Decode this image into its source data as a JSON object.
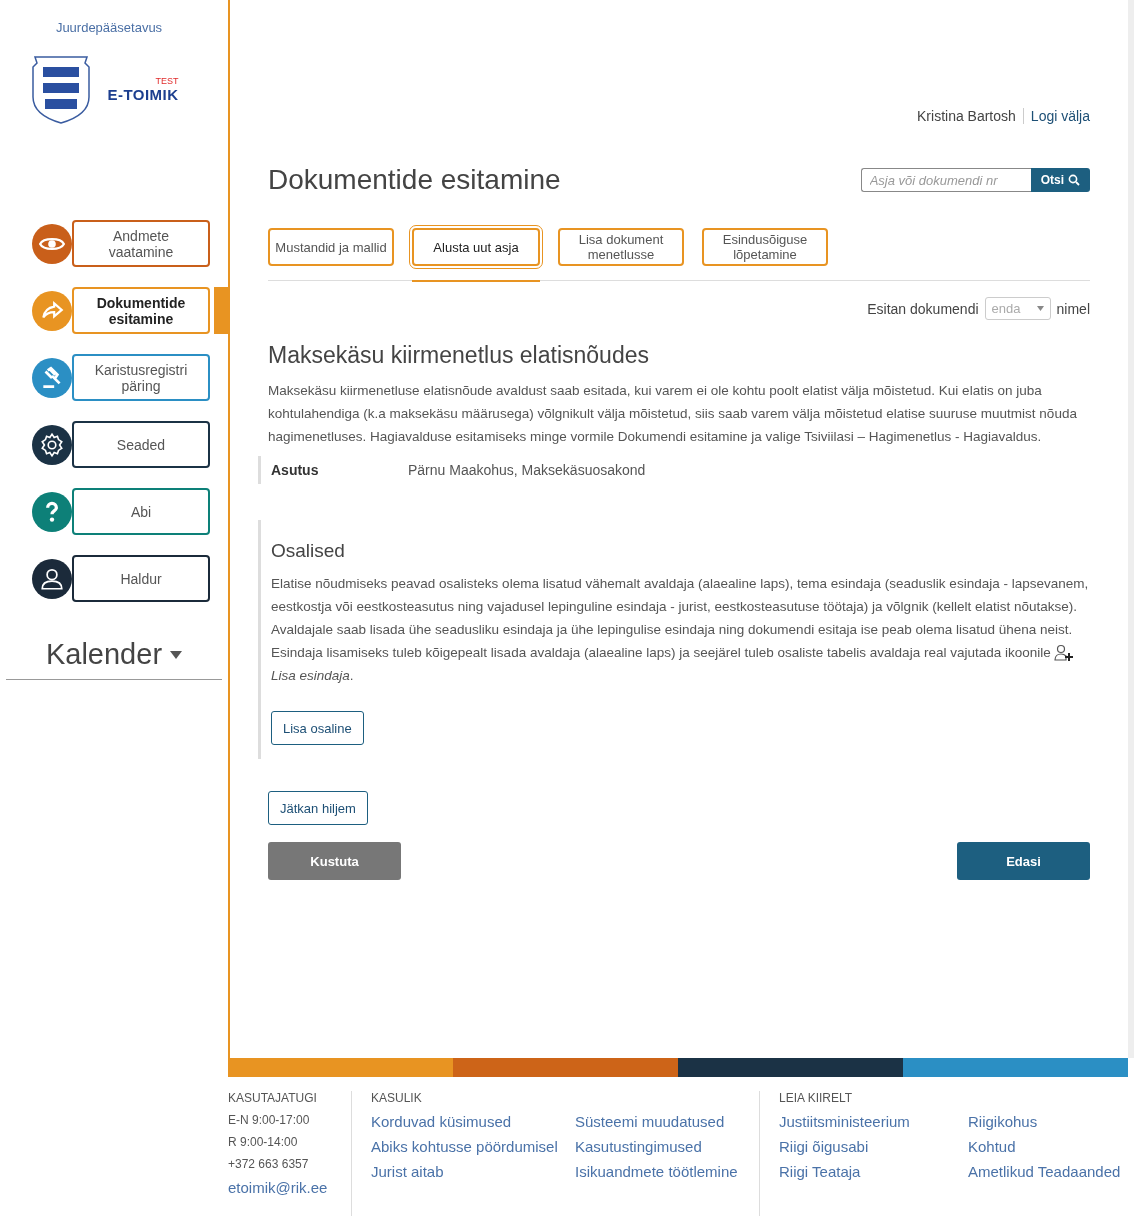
{
  "sidebar": {
    "accessibility_link": "Juurdepääsetavus",
    "logo": {
      "badge": "TEST",
      "name": "E-TOIMIK"
    },
    "nav": [
      {
        "label": "Andmete vaatamine",
        "color": "#c95f1a",
        "selected": false
      },
      {
        "label": "Dokumentide esitamine",
        "color": "#e89422",
        "selected": true
      },
      {
        "label": "Karistusregistri päring",
        "color": "#2b8fc4",
        "selected": false
      },
      {
        "label": "Seaded",
        "color": "#1b3245",
        "selected": false
      },
      {
        "label": "Abi",
        "color": "#0d8078",
        "selected": false
      },
      {
        "label": "Haldur",
        "color": "#1b2a3a",
        "selected": false
      }
    ],
    "calendar": "Kalender"
  },
  "header": {
    "user": "Kristina Bartosh",
    "logout": "Logi välja"
  },
  "page_title": "Dokumentide esitamine",
  "search": {
    "placeholder": "Asja või dokumendi nr",
    "button": "Otsi"
  },
  "tabs": [
    {
      "label": "Mustandid ja mallid",
      "selected": false
    },
    {
      "label": "Alusta uut asja",
      "selected": true
    },
    {
      "label": "Lisa dokument menetlusse",
      "selected": false
    },
    {
      "label": "Esindusõiguse lõpetamine",
      "selected": false
    }
  ],
  "submit_as": {
    "prefix": "Esitan dokumendi",
    "value": "enda",
    "suffix": "nimel"
  },
  "section": {
    "title": "Maksekäsu kiirmenetlus elatisnõudes",
    "description": "Maksekäsu kiirmenetluse elatisnõude avaldust saab esitada, kui varem ei ole kohtu poolt elatist välja mõistetud. Kui elatis on juba kohtulahendiga (k.a maksekäsu määrusega) võlgnikult välja mõistetud, siis saab varem välja mõistetud elatise suuruse muutmist nõuda hagimenetluses. Hagiavalduse esitamiseks minge vormile Dokumendi esitamine ja valige Tsiviilasi – Hagimenetlus - Hagiavaldus."
  },
  "institution": {
    "label": "Asutus",
    "value": "Pärnu Maakohus, Maksekäsuosakond"
  },
  "parties": {
    "title": "Osalised",
    "description": "Elatise nõudmiseks peavad osalisteks olema lisatud vähemalt avaldaja (alaealine laps), tema esindaja (seaduslik esindaja - lapsevanem, eestkostja või eestkosteasutus ning vajadusel lepinguline esindaja - jurist, eestkosteasutuse töötaja) ja võlgnik (kellelt elatist nõutakse). Avaldajale saab lisada ühe seadusliku esindaja ja ühe lepingulise esindaja ning dokumendi esitaja ise peab olema lisatud ühena neist. Esindaja lisamiseks tuleb kõigepealt lisada avaldaja (alaealine laps) ja seejärel tuleb osaliste tabelis avaldaja real vajutada ikoonile",
    "description_end": "*Lisa esindaja*.",
    "add_button": "Lisa osaline"
  },
  "actions": {
    "later": "Jätkan hiljem",
    "delete": "Kustuta",
    "next": "Edasi"
  },
  "footer": {
    "support": {
      "title": "KASUTAJATUGI",
      "lines": [
        "E-N 9:00-17:00",
        "R 9:00-14:00",
        "+372 663 6357"
      ],
      "email": "etoimik@rik.ee"
    },
    "useful": {
      "title": "KASULIK",
      "links": [
        "Korduvad küsimused",
        "Süsteemi muudatused",
        "Abiks kohtusse pöördumisel",
        "Kasutustingimused",
        "Jurist aitab",
        "Isikuandmete töötlemine"
      ]
    },
    "quick": {
      "title": "LEIA KIIRELT",
      "links": [
        "Justiitsministeerium",
        "Riigikohus",
        "Riigi õigusabi",
        "Kohtud",
        "Riigi Teataja",
        "Ametlikud Teadaanded"
      ]
    }
  }
}
